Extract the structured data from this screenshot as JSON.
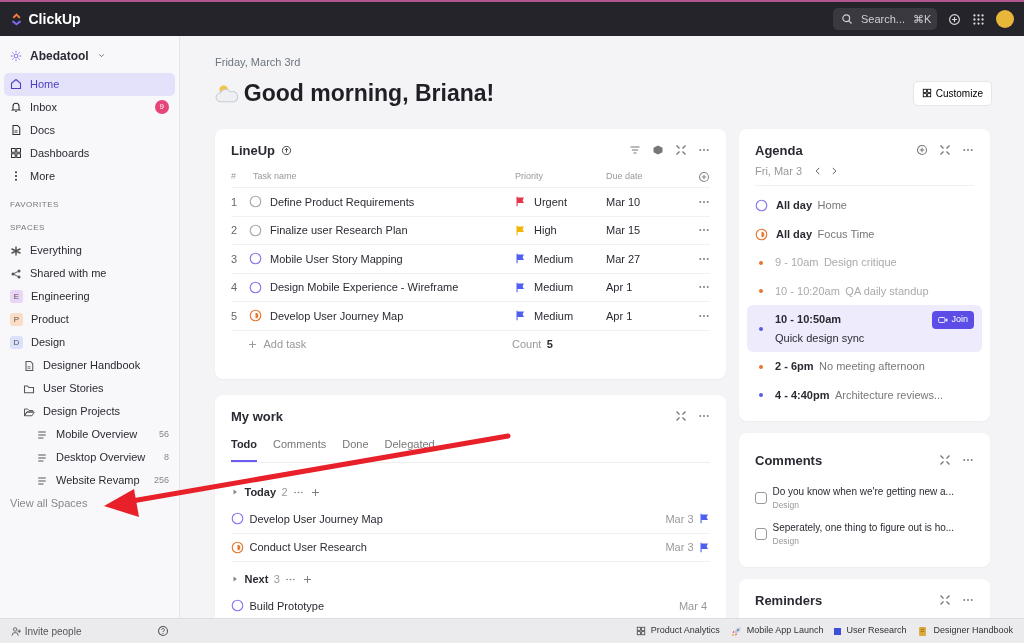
{
  "topbar": {
    "logo": "ClickUp",
    "search": {
      "placeholder": "Search...",
      "shortcut": "⌘K"
    }
  },
  "sidebar": {
    "workspace": "Abedatool",
    "nav": [
      {
        "label": "Home",
        "kind": "home",
        "selected": true
      },
      {
        "label": "Inbox",
        "kind": "bell",
        "selected": false,
        "badge": "9"
      },
      {
        "label": "Docs",
        "kind": "doc",
        "selected": false
      },
      {
        "label": "Dashboards",
        "kind": "grid",
        "selected": false
      },
      {
        "label": "More",
        "kind": "more",
        "selected": false
      }
    ],
    "favorites_heading": "FAVORITES",
    "spaces_heading": "SPACES",
    "spaces": [
      {
        "kind": "everything",
        "label": "Everything"
      },
      {
        "kind": "shared",
        "label": "Shared with me"
      },
      {
        "kind": "letter",
        "letter": "E",
        "label": "Engineering",
        "color": "#e9d5f5"
      },
      {
        "kind": "letter",
        "letter": "P",
        "label": "Product",
        "color": "#fbdcc4"
      },
      {
        "kind": "letter",
        "letter": "D",
        "label": "Design",
        "color": "#dbe1fb",
        "children": [
          {
            "kind": "doc",
            "label": "Designer Handbook"
          },
          {
            "kind": "folder",
            "label": "User Stories"
          },
          {
            "kind": "folder_open",
            "label": "Design Projects",
            "children": [
              {
                "kind": "list",
                "label": "Mobile Overview",
                "count": "56"
              },
              {
                "kind": "list",
                "label": "Desktop Overview",
                "count": "8"
              },
              {
                "kind": "list",
                "label": "Website Revamp",
                "count": "256"
              }
            ]
          }
        ]
      }
    ],
    "view_all": "View all Spaces",
    "invite": "Invite people"
  },
  "date": "Friday, March 3rd",
  "greeting": "Good morning, Briana!",
  "customize": "Customize",
  "lineup": {
    "title": "LineUp",
    "columns": [
      "#",
      "Task name",
      "Priority",
      "Due date"
    ],
    "rows": [
      {
        "number": "1",
        "kind": "todo",
        "name": "Define Product Requirements",
        "priority": {
          "label": "Urgent",
          "color": "#e5344c"
        },
        "due": "Mar 10"
      },
      {
        "number": "2",
        "kind": "todo",
        "name": "Finalize user Research Plan",
        "priority": {
          "label": "High",
          "color": "#f5b400"
        },
        "due": "Mar 15"
      },
      {
        "number": "3",
        "kind": "planned",
        "name": "Mobile User Story Mapping",
        "priority": {
          "label": "Medium",
          "color": "#4d5ef0"
        },
        "due": "Mar 27"
      },
      {
        "number": "4",
        "kind": "planned",
        "name": "Design Mobile Experience - Wireframe",
        "priority": {
          "label": "Medium",
          "color": "#4d5ef0"
        },
        "due": "Apr 1"
      },
      {
        "number": "5",
        "kind": "active",
        "name": "Develop User Journey Map",
        "priority": {
          "label": "Medium",
          "color": "#4d5ef0"
        },
        "due": "Apr 1"
      }
    ],
    "add_task": "Add task",
    "count_label": "Count",
    "count": "5"
  },
  "my_work": {
    "title": "My work",
    "tabs": [
      {
        "label": "Todo",
        "selected": true
      },
      {
        "label": "Comments",
        "selected": false
      },
      {
        "label": "Done",
        "selected": false
      },
      {
        "label": "Delegated",
        "selected": false
      }
    ],
    "groups": [
      {
        "label": "Today",
        "count": "2",
        "tasks": [
          {
            "kind": "planned",
            "name": "Develop User Journey Map",
            "due": "Mar 3",
            "color": "#4d5ef0"
          },
          {
            "kind": "active",
            "name": "Conduct User Research",
            "due": "Mar 3",
            "color": "#4d5ef0"
          }
        ]
      },
      {
        "label": "Next",
        "count": "3",
        "tasks": [
          {
            "kind": "planned",
            "name": "Build Prototype",
            "due": "Mar 4"
          }
        ]
      }
    ]
  },
  "agenda": {
    "title": "Agenda",
    "date": "Fri, Mar 3",
    "events": [
      {
        "kind": "allday",
        "color": "#8478f0",
        "in_progress": false,
        "time": "All day",
        "title": "Home",
        "past": false,
        "current": false
      },
      {
        "kind": "allday",
        "color": "#e8772e",
        "in_progress": true,
        "time": "All day",
        "title": "Focus Time",
        "past": false,
        "current": false
      },
      {
        "kind": "timed",
        "color": "#e8772e",
        "time": "9 - 10am",
        "title": "Design critique",
        "past": true,
        "current": false
      },
      {
        "kind": "timed",
        "color": "#e8772e",
        "time": "10 - 10:20am",
        "title": "QA daily standup",
        "past": true,
        "current": false
      },
      {
        "kind": "timed",
        "color": "#5b5ce6",
        "time": "10 - 10:50am",
        "title": "Quick design sync",
        "past": false,
        "current": true,
        "join": "Join"
      },
      {
        "kind": "timed",
        "color": "#e8772e",
        "time": "2 - 6pm",
        "title": "No meeting afternoon",
        "past": false,
        "current": false
      },
      {
        "kind": "timed",
        "color": "#5b5ce6",
        "time": "4 - 4:40pm",
        "title": "Architecture reviews...",
        "past": false,
        "current": false
      }
    ]
  },
  "comments": {
    "title": "Comments",
    "items": [
      {
        "text": "Do you know when we're getting new a...",
        "space": "Design",
        "checked": false
      },
      {
        "text": "Seperately, one thing to figure out is ho...",
        "space": "Design",
        "checked": false
      }
    ]
  },
  "reminders": {
    "title": "Reminders"
  },
  "footer_items": [
    {
      "kind": "grid",
      "label": "Product Analytics"
    },
    {
      "kind": "rocket",
      "label": "Mobile App Launch"
    },
    {
      "kind": "square",
      "label": "User Research",
      "color": "#3b4fd8"
    },
    {
      "kind": "doc",
      "label": "Designer Handbook"
    }
  ]
}
